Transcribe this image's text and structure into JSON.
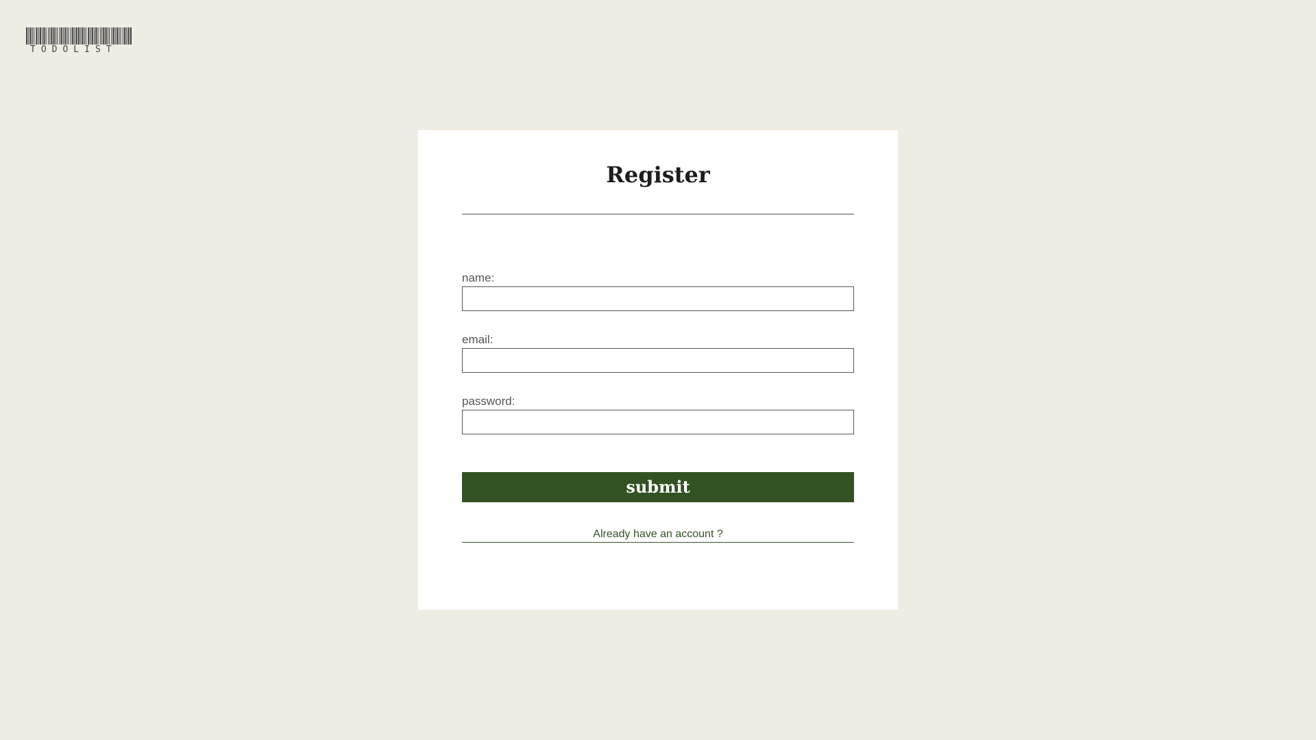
{
  "logo": {
    "text": "TODOLIST"
  },
  "form": {
    "title": "Register",
    "fields": [
      {
        "label": "name:",
        "value": ""
      },
      {
        "label": "email:",
        "value": ""
      },
      {
        "label": "password:",
        "value": ""
      }
    ],
    "submit_label": "submit",
    "login_link": "Already have an account ?"
  },
  "colors": {
    "background": "#efece4",
    "card": "#ffffff",
    "accent": "#335223"
  }
}
